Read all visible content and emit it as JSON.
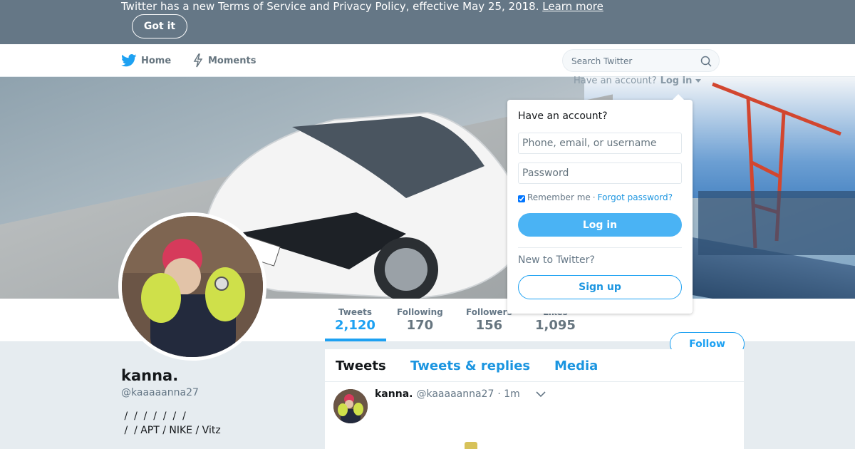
{
  "banner": {
    "text": "Twitter has a new Terms of Service and Privacy Policy, effective May 25, 2018.",
    "link": "Learn more",
    "got_it": "Got it"
  },
  "nav": {
    "home": "Home",
    "moments": "Moments",
    "search_placeholder": "Search Twitter"
  },
  "login": {
    "prompt": "Have an account?",
    "toggle": "Log in",
    "title": "Have an account?",
    "username_placeholder": "Phone, email, or username",
    "password_placeholder": "Password",
    "remember": "Remember me",
    "separator": "·",
    "forgot": "Forgot password?",
    "login_button": "Log in",
    "new_to": "New to Twitter?",
    "signup_button": "Sign up"
  },
  "stats": [
    {
      "label": "Tweets",
      "value": "2,120"
    },
    {
      "label": "Following",
      "value": "170"
    },
    {
      "label": "Followers",
      "value": "156"
    },
    {
      "label": "Likes",
      "value": "1,095"
    }
  ],
  "follow_button": "Follow",
  "profile": {
    "name": "kanna.",
    "handle": "@kaaaaanna27",
    "bio": " /  /  /  /  /  /  /\n /  / APT / NIKE / Vitz"
  },
  "tabs": [
    "Tweets",
    "Tweets & replies",
    "Media"
  ],
  "tweet": {
    "name": "kanna.",
    "handle": "@kaaaaanna27",
    "time": "· 1m"
  },
  "colors": {
    "banner_bg": "#657786",
    "accent": "#1da1f2",
    "login_button": "#4ab3f4",
    "page_bg": "#e6ecf0"
  },
  "icons": {
    "home": "twitter-bird-icon",
    "moments": "lightning-icon",
    "search": "search-icon",
    "caret": "chevron-down-icon"
  }
}
